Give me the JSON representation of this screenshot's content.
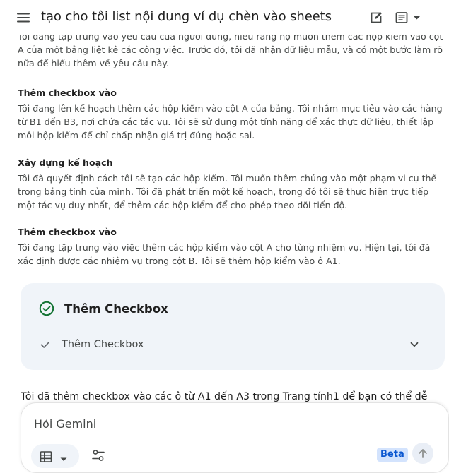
{
  "header": {
    "title": "tạo cho tôi list nội dung ví dụ chèn vào sheets",
    "menu_icon": "hamburger-menu-icon",
    "edit_icon": "edit-icon",
    "view_icon": "document-view-icon"
  },
  "thoughts": {
    "intro": "Tôi đang tập trung vào yêu cầu của người dùng, hiểu rằng họ muốn thêm các hộp kiểm vào cột A của một bảng liệt kê các công việc. Trước đó, tôi đã nhận dữ liệu mẫu, và có một bước làm rõ nữa để hiểu thêm về yêu cầu này.",
    "sections": [
      {
        "heading": "Thêm checkbox vào",
        "body": "Tôi đang lên kế hoạch thêm các hộp kiểm vào cột A của bảng. Tôi nhắm mục tiêu vào các hàng từ B1 đến B3, nơi chứa các tác vụ. Tôi sẽ sử dụng một tính năng để xác thực dữ liệu, thiết lập mỗi hộp kiểm để chỉ chấp nhận giá trị đúng hoặc sai."
      },
      {
        "heading": "Xây dựng kế hoạch",
        "body": "Tôi đã quyết định cách tôi sẽ tạo các hộp kiểm. Tôi muốn thêm chúng vào một phạm vi cụ thể trong bảng tính của mình. Tôi đã phát triển một kế hoạch, trong đó tôi sẽ thực hiện trực tiếp một tác vụ duy nhất, để thêm các hộp kiểm để cho phép theo dõi tiến độ."
      },
      {
        "heading": "Thêm checkbox vào",
        "body": "Tôi đang tập trung vào việc thêm các hộp kiểm vào cột A cho từng nhiệm vụ. Hiện tại, tôi đã xác định được các nhiệm vụ trong cột B. Tôi sẽ thêm hộp kiểm vào ô A1."
      }
    ]
  },
  "action_card": {
    "title": "Thêm Checkbox",
    "step_label": "Thêm Checkbox",
    "status_color": "#137333"
  },
  "response_preview": "Tôi đã thêm checkbox vào các ô từ A1 đến A3 trong Trang tính1 để bạn có thể dễ",
  "composer": {
    "placeholder": "Hỏi Gemini",
    "badge": "Beta",
    "tools_icon": "table-icon",
    "settings_icon": "tune-icon",
    "send_icon": "send-arrow-icon"
  }
}
